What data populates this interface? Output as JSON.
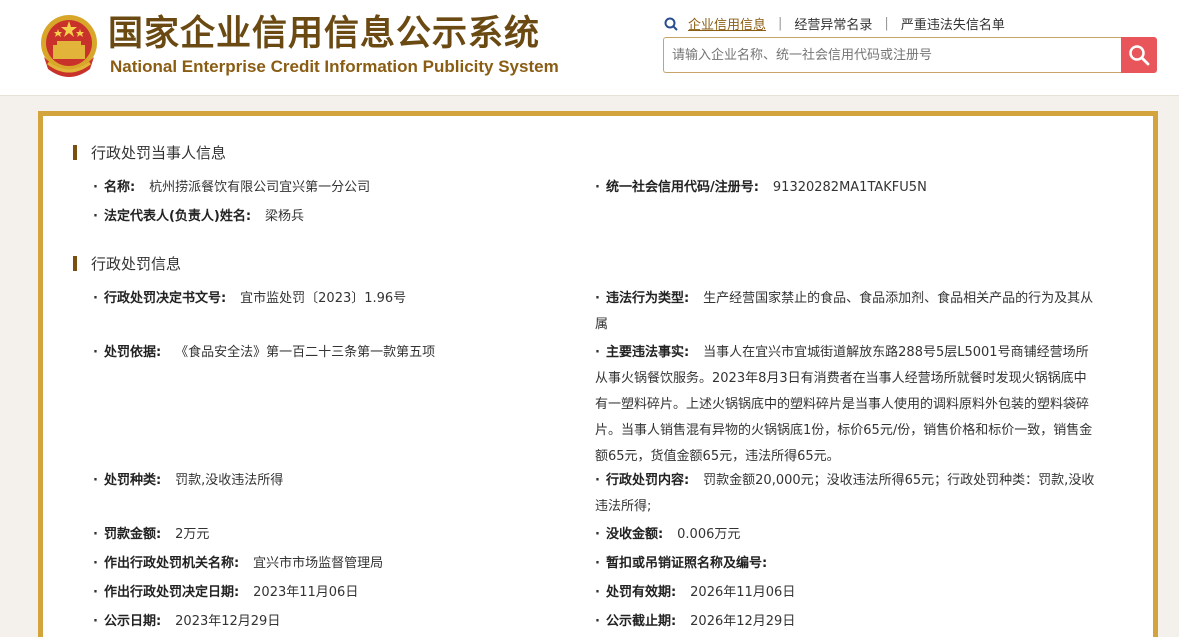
{
  "header": {
    "title_cn": "国家企业信用信息公示系统",
    "title_en": "National Enterprise Credit Information Publicity System",
    "links": [
      "企业信用信息",
      "经营异常名录",
      "严重违法失信名单"
    ],
    "search_placeholder": "请输入企业名称、统一社会信用代码或注册号"
  },
  "party": {
    "section_title": "行政处罚当事人信息",
    "name_label": "名称:",
    "name_value": "杭州捞派餐饮有限公司宜兴第一分公司",
    "credit_code_label": "统一社会信用代码/注册号:",
    "credit_code_value": "91320282MA1TAKFU5N",
    "legal_rep_label": "法定代表人(负责人)姓名:",
    "legal_rep_value": "梁杨兵"
  },
  "penalty": {
    "section_title": "行政处罚信息",
    "doc_no_label": "行政处罚决定书文号:",
    "doc_no_value": "宜市监处罚〔2023〕1.96号",
    "violation_type_label": "违法行为类型:",
    "violation_type_value": "生产经营国家禁止的食品、食品添加剂、食品相关产品的行为及其从属",
    "basis_label": "处罚依据:",
    "basis_value": "《食品安全法》第一百二十三条第一款第五项",
    "facts_label": "主要违法事实:",
    "facts_value": "当事人在宜兴市宜城街道解放东路288号5层L5001号商铺经营场所从事火锅餐饮服务。2023年8月3日有消费者在当事人经营场所就餐时发现火锅锅底中有一塑料碎片。上述火锅锅底中的塑料碎片是当事人使用的调料原料外包装的塑料袋碎片。当事人销售混有异物的火锅锅底1份，标价65元/份，销售价格和标价一致，销售金额65元，货值金额65元，违法所得65元。",
    "kind_label": "处罚种类:",
    "kind_value": "罚款,没收违法所得",
    "content_label": "行政处罚内容:",
    "content_value": "罚款金额20,000元；没收违法所得65元；行政处罚种类：罚款,没收违法所得;",
    "fine_label": "罚款金额:",
    "fine_value": "2万元",
    "confiscation_label": "没收金额:",
    "confiscation_value": "0.006万元",
    "authority_label": "作出行政处罚机关名称:",
    "authority_value": "宜兴市市场监督管理局",
    "license_label": "暂扣或吊销证照名称及编号:",
    "license_value": "",
    "decision_date_label": "作出行政处罚决定日期:",
    "decision_date_value": "2023年11月06日",
    "valid_until_label": "处罚有效期:",
    "valid_until_value": "2026年11月06日",
    "publicity_date_label": "公示日期:",
    "publicity_date_value": "2023年12月29日",
    "publicity_end_label": "公示截止期:",
    "publicity_end_value": "2026年12月29日"
  },
  "colors": {
    "brand_brown": "#6a4a12",
    "panel_border": "#d4a43c",
    "search_button": "#e8555a"
  }
}
